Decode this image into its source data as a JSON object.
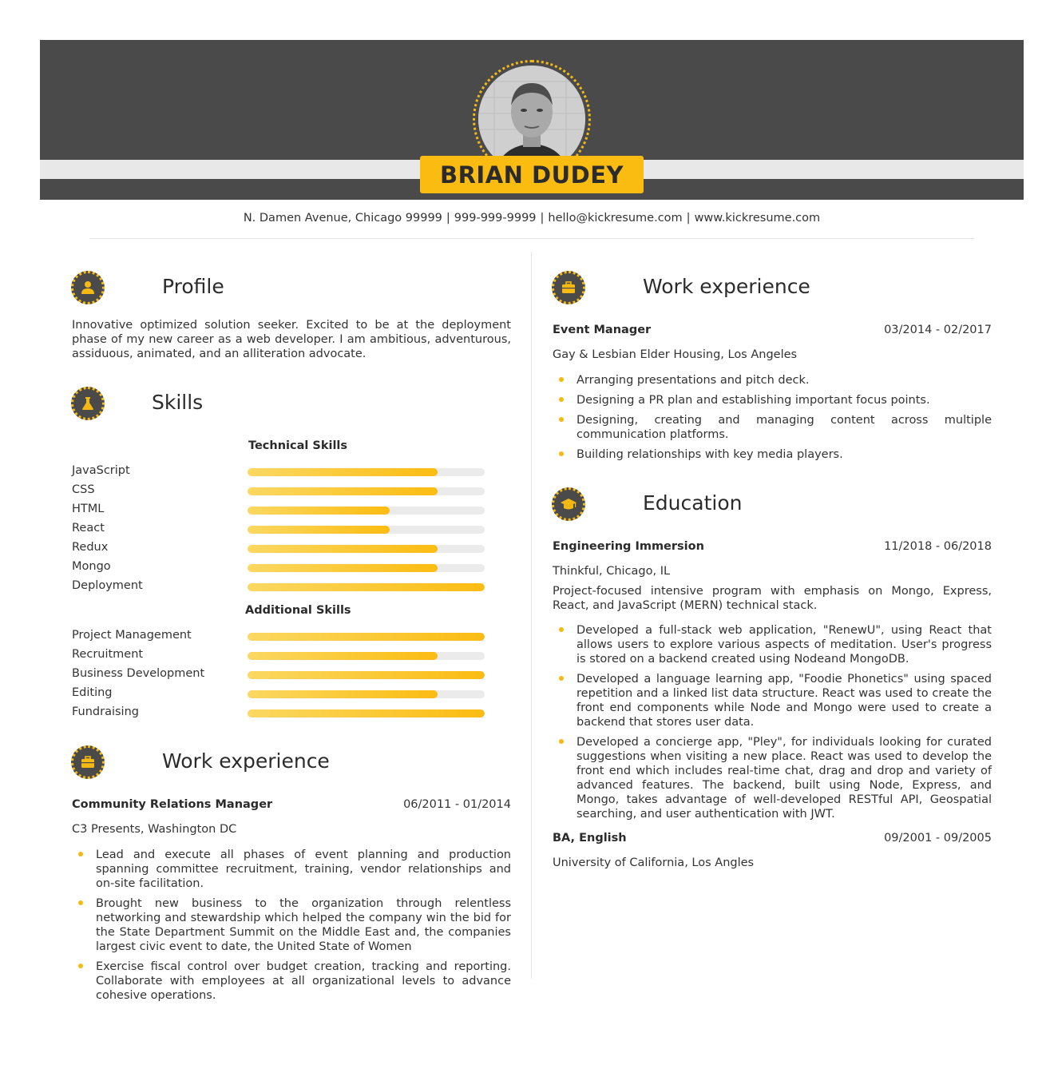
{
  "header": {
    "name": "BRIAN DUDEY",
    "photo_alt": "profile-photo"
  },
  "contact": {
    "address": "N. Damen Avenue, Chicago 99999",
    "phone": "999-999-9999",
    "email": "hello@kickresume.com",
    "website": "www.kickresume.com",
    "separator": "|"
  },
  "profile": {
    "title": "Profile",
    "text": "Innovative optimized solution seeker. Excited to be at the deployment phase of my new career as a web developer. I am ambitious, adventurous, assiduous, animated, and an alliteration advocate."
  },
  "skills": {
    "title": "Skills",
    "technical_heading": "Technical Skills",
    "technical": [
      {
        "label": "JavaScript",
        "level": 0.8
      },
      {
        "label": "CSS",
        "level": 0.8
      },
      {
        "label": "HTML",
        "level": 0.6
      },
      {
        "label": "React",
        "level": 0.6
      },
      {
        "label": "Redux",
        "level": 0.8
      },
      {
        "label": "Mongo",
        "level": 0.8
      },
      {
        "label": "Deployment",
        "level": 1.0
      }
    ],
    "additional_heading": "Additional Skills",
    "additional": [
      {
        "label": "Project Management",
        "level": 1.0
      },
      {
        "label": "Recruitment",
        "level": 0.8
      },
      {
        "label": "Business Development",
        "level": 1.0
      },
      {
        "label": "Editing",
        "level": 0.8
      },
      {
        "label": "Fundraising",
        "level": 1.0
      }
    ]
  },
  "work_left": {
    "title": "Work experience",
    "jobs": [
      {
        "title": "Community Relations Manager",
        "dates": "06/2011 - 01/2014",
        "org": "C3 Presents, Washington DC",
        "bullets": [
          "Lead and execute all phases of event planning and production spanning committee recruitment, training, vendor relationships and on-site facilitation.",
          "Brought new business to the organization through relentless networking and stewardship which helped the company win the bid for the State Department Summit on the Middle East and, the companies largest civic event to date, the United State of Women",
          "Exercise fiscal control over budget creation, tracking and reporting. Collaborate with employees at all organizational levels to advance cohesive operations."
        ]
      }
    ]
  },
  "work_right": {
    "title": "Work experience",
    "jobs": [
      {
        "title": "Event Manager",
        "dates": "03/2014 - 02/2017",
        "org": "Gay & Lesbian Elder Housing, Los Angeles",
        "bullets": [
          "Arranging presentations and pitch deck.",
          "Designing a PR plan and establishing important focus points.",
          "Designing, creating and managing content across multiple communication platforms.",
          "Building relationships with key media players."
        ]
      }
    ]
  },
  "education": {
    "title": "Education",
    "items": [
      {
        "title": "Engineering Immersion",
        "dates": "11/2018 - 06/2018",
        "org": "Thinkful, Chicago, IL",
        "description": "Project-focused intensive program with emphasis on Mongo, Express, React, and JavaScript (MERN) technical stack.",
        "bullets": [
          "Developed a full-stack web application, \"RenewU\", using React that allows users to explore various aspects of meditation. User's progress is stored on a backend created using Nodeand MongoDB.",
          "Developed a language learning app, \"Foodie Phonetics\" using spaced repetition and a linked list data structure. React was used to create the front end components while Node and Mongo were used to create a backend that stores user data.",
          "Developed a concierge app, \"Pley\", for individuals looking for curated suggestions when visiting a new place. React was used to develop the front end which includes real-time chat, drag and drop and variety of advanced features. The backend, built using Node, Express, and Mongo, takes advantage of well-developed RESTful API, Geospatial searching, and user authentication with JWT."
        ]
      },
      {
        "title": "BA, English",
        "dates": "09/2001 - 09/2005",
        "org": "University of California, Los Angles"
      }
    ]
  },
  "colors": {
    "accent": "#fbbc12",
    "header": "#4a4a4a",
    "stripe": "#e8e8e8"
  }
}
